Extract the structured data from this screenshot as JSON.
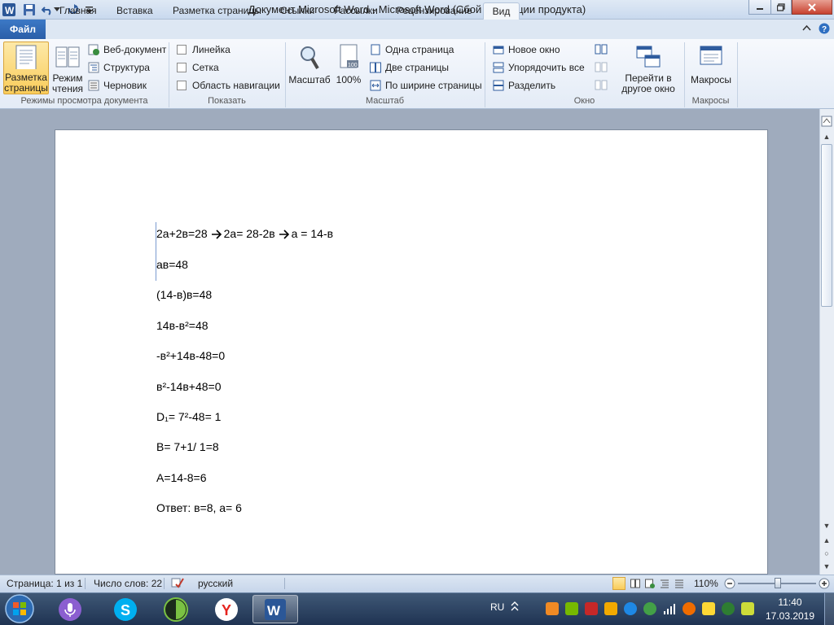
{
  "window": {
    "title": "Документ Microsoft Word  -  Microsoft Word (Сбой активации продукта)"
  },
  "tabs": {
    "file": "Файл",
    "items": [
      "Главная",
      "Вставка",
      "Разметка страницы",
      "Ссылки",
      "Рассылки",
      "Рецензирование",
      "Вид"
    ],
    "active": "Вид"
  },
  "ribbon": {
    "views": {
      "print_layout": "Разметка страницы",
      "print_layout_l1": "Разметка",
      "print_layout_l2": "страницы",
      "reading_l1": "Режим",
      "reading_l2": "чтения",
      "web": "Веб-документ",
      "outline": "Структура",
      "draft": "Черновик",
      "group_label": "Режимы просмотра документа"
    },
    "show": {
      "ruler": "Линейка",
      "grid": "Сетка",
      "nav": "Область навигации",
      "group_label": "Показать"
    },
    "zoom": {
      "zoom_btn": "Масштаб",
      "hundred": "100%",
      "one_page": "Одна страница",
      "two_pages": "Две страницы",
      "page_width": "По ширине страницы",
      "group_label": "Масштаб"
    },
    "window": {
      "new_window": "Новое окно",
      "arrange_all": "Упорядочить все",
      "split": "Разделить",
      "switch_l1": "Перейти в",
      "switch_l2": "другое окно",
      "group_label": "Окно"
    },
    "macros": {
      "macros_btn": "Макросы",
      "group_label": "Макросы"
    }
  },
  "document": {
    "lines": [
      "2а+2в=28",
      "2а= 28-2в",
      "а = 14-в",
      "ав=48",
      "(14-в)в=48",
      " 14в-в²=48",
      "-в²+14в-48=0",
      "в²-14в+48=0",
      "D₁= 7²-48= 1",
      "В= 7+1/ 1=8",
      "А=14-8=6",
      "Ответ: в=8, а= 6"
    ]
  },
  "statusbar": {
    "page": "Страница: 1 из 1",
    "words": "Число слов: 22",
    "language": "русский",
    "zoom": "110%"
  },
  "taskbar": {
    "lang": "RU",
    "time": "11:40",
    "date": "17.03.2019"
  },
  "colors": {
    "file_tab": "#2a5ea8",
    "selected_view": "#f9cc5a",
    "taskbar": "#1f3352"
  }
}
